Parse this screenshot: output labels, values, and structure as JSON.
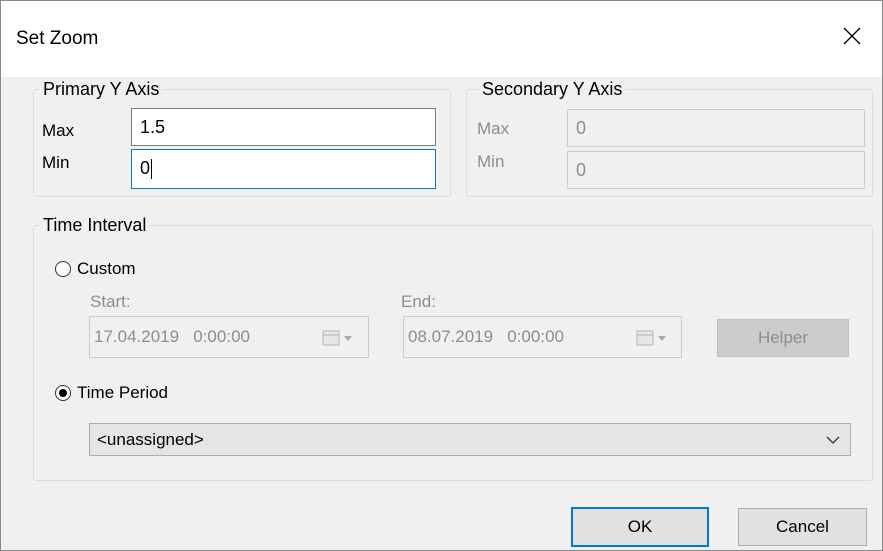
{
  "dialog": {
    "title": "Set Zoom"
  },
  "primary_axis": {
    "legend": "Primary Y Axis",
    "max_label": "Max",
    "max_value": "1.5",
    "min_label": "Min",
    "min_value": "0"
  },
  "secondary_axis": {
    "legend": "Secondary Y Axis",
    "max_label": "Max",
    "max_value": "0",
    "min_label": "Min",
    "min_value": "0"
  },
  "time_interval": {
    "legend": "Time Interval",
    "custom_label": "Custom",
    "custom_selected": false,
    "start_label": "Start:",
    "start_value": "17.04.2019   0:00:00",
    "end_label": "End:",
    "end_value": "08.07.2019   0:00:00",
    "helper_label": "Helper",
    "time_period_label": "Time Period",
    "time_period_selected": true,
    "time_period_value": "<unassigned>"
  },
  "buttons": {
    "ok_label": "OK",
    "cancel_label": "Cancel"
  },
  "colors": {
    "accent": "#0078d7",
    "disabled_text": "#8d8d8d",
    "window_bg": "#f0f0f0"
  }
}
